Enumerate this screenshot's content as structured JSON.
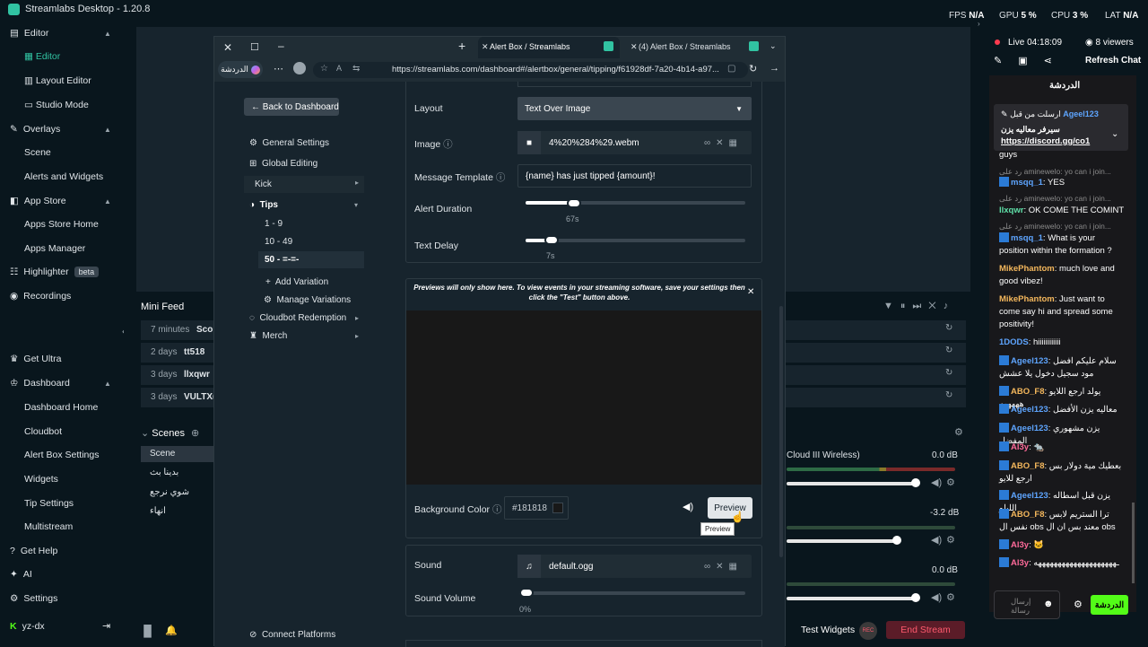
{
  "app": {
    "title": "Streamlabs Desktop - 1.20.8"
  },
  "stats": [
    {
      "label": "FPS",
      "value": "N/A"
    },
    {
      "label": "GPU",
      "value": "5 %"
    },
    {
      "label": "CPU",
      "value": "3 %"
    },
    {
      "label": "LAT",
      "value": "N/A"
    }
  ],
  "nav": {
    "editor": "Editor",
    "editor_items": [
      "Editor",
      "Layout Editor",
      "Studio Mode"
    ],
    "overlays": "Overlays",
    "overlays_items": [
      "Scene",
      "Alerts and Widgets"
    ],
    "app_store": "App Store",
    "app_store_items": [
      "Apps Store Home",
      "Apps Manager"
    ],
    "highlighter": "Highlighter",
    "beta": "beta",
    "recordings": "Recordings",
    "get_ultra": "Get Ultra",
    "dashboard": "Dashboard",
    "dashboard_items": [
      "Dashboard Home",
      "Cloudbot",
      "Alert Box Settings",
      "Widgets",
      "Tip Settings",
      "Multistream"
    ],
    "get_help": "Get Help",
    "ai": "AI",
    "settings": "Settings",
    "user": "yz-dx"
  },
  "minifeed": {
    "title": "Mini Feed",
    "rows": [
      {
        "time": "7 minutes",
        "name": "Scor"
      },
      {
        "time": "2 days",
        "name": "tt518"
      },
      {
        "time": "3 days",
        "name": "llxqwr"
      },
      {
        "time": "3 days",
        "name": "VULTX("
      }
    ]
  },
  "scenes": {
    "title": "Scenes",
    "items": [
      "Scene",
      "بدينا بث",
      "شوي نرجع",
      "انهاء"
    ]
  },
  "mixer": {
    "device": "Cloud III Wireless)",
    "levels": [
      "0.0 dB",
      "-3.2 dB",
      "0.0 dB"
    ],
    "channel_volumes": [
      0.96,
      0.83,
      0.96
    ]
  },
  "bottom": {
    "test_widgets": "Test Widgets",
    "rec": "REC",
    "end_stream": "End Stream"
  },
  "browser": {
    "tabs": [
      "Alert Box / Streamlabs",
      "(4) Alert Box / Streamlabs"
    ],
    "chat_button": "الدردشة",
    "url": "https://streamlabs.com/dashboard#/alertbox/general/tipping/f61928df-7a20-4b14-a97..."
  },
  "alertbox": {
    "back": "Back to Dashboard",
    "menu": [
      "General Settings",
      "Global Editing",
      "Kick",
      "Tips"
    ],
    "tips_sub": [
      "1 - 9",
      "10 - 49",
      "50 - =-=-"
    ],
    "add_variation": "Add Variation",
    "manage_variations": "Manage Variations",
    "cloudbot": "Cloudbot Redemption",
    "merch": "Merch",
    "connect": "Connect Platforms",
    "layout_label": "Layout",
    "layout_value": "Text Over Image",
    "image_label": "Image",
    "image_value": "4%20%284%29.webm",
    "template_label": "Message Template",
    "template_value": "{name} has just tipped {amount}!",
    "duration_label": "Alert Duration",
    "duration_value": "67s",
    "duration_fraction": 0.22,
    "delay_label": "Text Delay",
    "delay_value": "7s",
    "delay_fraction": 0.12,
    "preview_note": "Previews will only show here. To view events in your streaming software, save your settings then click the \"Test\" button above.",
    "bg_label": "Background Color",
    "bg_value": "#181818",
    "preview_btn": "Preview",
    "preview_tip": "Preview",
    "sound_label": "Sound",
    "sound_value": "default.ogg",
    "volume_label": "Sound Volume",
    "volume_value": "0%",
    "volume_fraction": 0
  },
  "chat": {
    "live": "Live 04:18:09",
    "viewers": "8 viewers",
    "refresh": "Refresh Chat",
    "header": "الدردشة",
    "pinned_user": "Ageel123",
    "pinned_note": "ارسلت من قبل",
    "pinned_text": "سيرفر معاليه يزن",
    "pinned_link": "https://discord.gg/co1",
    "messages": [
      {
        "user": "",
        "text": "guys",
        "color": "u-blue"
      },
      {
        "user": "",
        "text": "رد على aminewelo: yo can i join...",
        "color": "reply"
      },
      {
        "user": "msqq_1",
        "text": "YES",
        "color": "u-blue"
      },
      {
        "user": "",
        "text": "رد على aminewelo: yo can i join...",
        "color": "reply"
      },
      {
        "user": "llxqwr",
        "text": "OK COME THE COMINT",
        "color": "u-green"
      },
      {
        "user": "",
        "text": "رد على aminewelo: yo can i join...",
        "color": "reply"
      },
      {
        "user": "msqq_1",
        "text": "What is your position within the formation ?",
        "color": "u-blue"
      },
      {
        "user": "MikePhantom",
        "text": "much love and good vibez!",
        "color": "u-orange"
      },
      {
        "user": "MikePhantom",
        "text": "Just want to come say hi and spread some positivity!",
        "color": "u-orange"
      },
      {
        "user": "1DODS",
        "text": "hiiiiiiiiiiii",
        "color": "u-blue"
      },
      {
        "user": "Ageel123",
        "text": "سلام عليكم افضل مود سجيل دخول يلا عشش",
        "color": "u-blue"
      },
      {
        "user": "ABO_F8",
        "text": "يولد ارجع اللايو هههههه",
        "color": "u-orange"
      },
      {
        "user": "Ageel123",
        "text": "معاليه يزن الأفضل",
        "color": "u-blue"
      },
      {
        "user": "Ageel123",
        "text": "يزن مشهوري المفضل",
        "color": "u-blue"
      },
      {
        "user": "Al3y",
        "text": "🐀",
        "color": "u-red"
      },
      {
        "user": "ABO_F8",
        "text": "بعطيك مية دولار بس ارجع للايو",
        "color": "u-orange"
      },
      {
        "user": "Ageel123",
        "text": "يزن قبل اسطاله الليلو",
        "color": "u-blue"
      },
      {
        "user": "ABO_F8",
        "text": "ترا الستريم لابس نفس ال obs معند بس ان ال obs",
        "color": "u-orange"
      },
      {
        "user": "Al3y",
        "text": "🐱",
        "color": "u-red"
      },
      {
        "user": "Al3y",
        "text": "ـههههههههههههههههههههه",
        "color": "u-red"
      }
    ],
    "input_placeholder": "إرسال رسالة",
    "send": "الدردشة"
  },
  "colors": {
    "accent": "#31c3a2",
    "bg": "#09161d",
    "panel": "#17242d",
    "danger": "#ff5a6e"
  }
}
